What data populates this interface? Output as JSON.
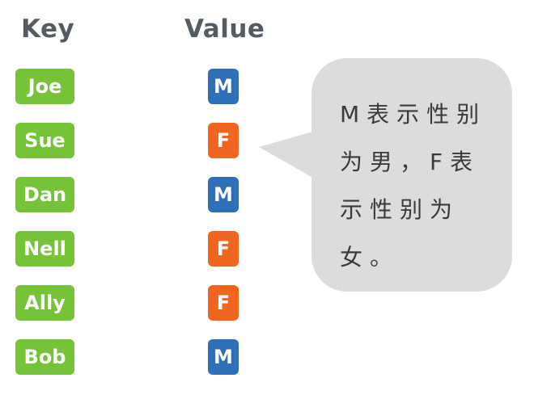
{
  "headers": {
    "key": "Key",
    "value": "Value"
  },
  "pairs": [
    {
      "key": "Joe",
      "value": "M"
    },
    {
      "key": "Sue",
      "value": "F"
    },
    {
      "key": "Dan",
      "value": "M"
    },
    {
      "key": "Nell",
      "value": "F"
    },
    {
      "key": "Ally",
      "value": "F"
    },
    {
      "key": "Bob",
      "value": "M"
    }
  ],
  "colors": {
    "key_pill": "#76c33a",
    "value_m": "#2f6fb8",
    "value_f": "#f0651f",
    "bubble": "#dcdcdc",
    "header_text": "#555c61"
  },
  "bubble": {
    "text": "M表示性别为男，F表示性别为女。"
  }
}
